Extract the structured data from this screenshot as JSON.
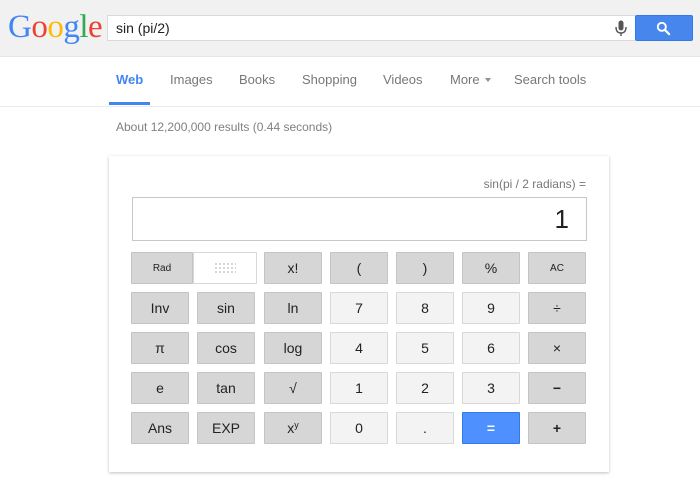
{
  "logo": {
    "letters": [
      "G",
      "o",
      "o",
      "g",
      "l",
      "e"
    ],
    "colors": [
      "#4285f4",
      "#ea4335",
      "#fbbc05",
      "#4285f4",
      "#34a853",
      "#ea4335"
    ]
  },
  "search": {
    "query": "sin (pi/2)",
    "mic_icon": "microphone-icon",
    "button_icon": "search-icon"
  },
  "tabs": [
    {
      "label": "Web",
      "active": true
    },
    {
      "label": "Images"
    },
    {
      "label": "Books"
    },
    {
      "label": "Shopping"
    },
    {
      "label": "Videos"
    },
    {
      "label": "More"
    },
    {
      "label": "Search tools"
    }
  ],
  "stats": "About 12,200,000 results (0.44 seconds)",
  "calculator": {
    "expression": "sin(pi / 2 radians) =",
    "result": "1",
    "keys": {
      "rad": "Rad",
      "fact": "x!",
      "lparen": "(",
      "rparen": ")",
      "percent": "%",
      "ac": "AC",
      "inv": "Inv",
      "sin": "sin",
      "ln": "ln",
      "n7": "7",
      "n8": "8",
      "n9": "9",
      "divide": "÷",
      "pi": "π",
      "cos": "cos",
      "log": "log",
      "n4": "4",
      "n5": "5",
      "n6": "6",
      "multiply": "×",
      "e": "e",
      "tan": "tan",
      "sqrt": "√",
      "n1": "1",
      "n2": "2",
      "n3": "3",
      "minus": "−",
      "ans": "Ans",
      "exp": "EXP",
      "pow_base": "x",
      "pow_exp": "y",
      "n0": "0",
      "dot": ".",
      "equals": "=",
      "plus": "+"
    }
  },
  "accent_color": "#4285f4"
}
